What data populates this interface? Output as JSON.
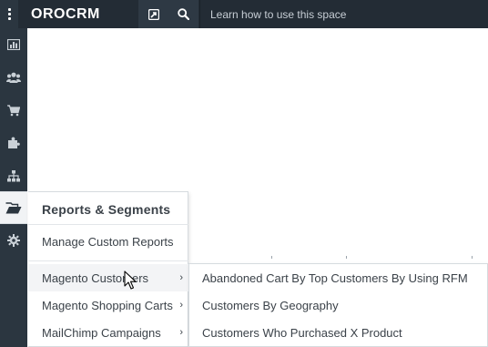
{
  "topbar": {
    "logo": "OROCRM",
    "learn_link": "Learn how to use this space",
    "icons": [
      "menu-dots-icon",
      "pin-icon",
      "search-icon"
    ]
  },
  "leftnav": {
    "items": [
      {
        "icon": "dashboard-chart-icon"
      },
      {
        "icon": "customers-group-icon"
      },
      {
        "icon": "shopping-cart-icon"
      },
      {
        "icon": "puzzle-piece-icon"
      },
      {
        "icon": "sitemap-icon"
      },
      {
        "icon": "folder-open-icon",
        "active": true
      },
      {
        "icon": "gear-icon"
      }
    ]
  },
  "dropdown": {
    "header": "Reports & Segments",
    "manage": "Manage Custom Reports",
    "submenus": [
      {
        "label": "Magento Customers",
        "chevron": "›",
        "hover": true
      },
      {
        "label": "Magento Shopping Carts",
        "chevron": "›"
      },
      {
        "label": "MailChimp Campaigns",
        "chevron": "›"
      }
    ]
  },
  "submenu": {
    "items": [
      {
        "label": "Abandoned Cart By Top Customers By Using RFM"
      },
      {
        "label": "Customers By Geography"
      },
      {
        "label": "Customers Who Purchased X Product"
      }
    ]
  },
  "colors": {
    "topbar_bg": "#232c35",
    "nav_bg": "#2b3640",
    "text": "#3b4249",
    "hover_bg": "#f3f4f6"
  }
}
